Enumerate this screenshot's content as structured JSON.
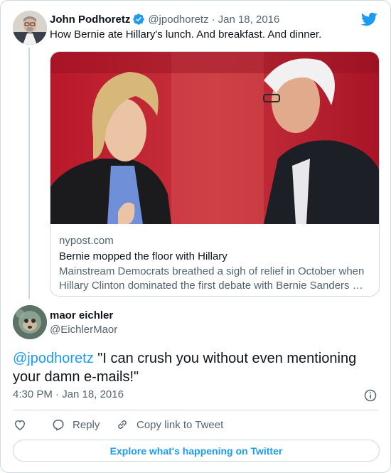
{
  "colors": {
    "accent": "#1d9bf0",
    "text": "#0f1419",
    "muted": "#536471",
    "border": "#cfd9de"
  },
  "parent_tweet": {
    "author_name": "John Podhoretz",
    "verified_icon": "verified-badge-icon",
    "handle": "@jpodhoretz",
    "separator": "·",
    "date": "Jan 18, 2016",
    "text": "How Bernie ate Hillary's lunch. And breakfast. And dinner.",
    "link_card": {
      "domain": "nypost.com",
      "title": "Bernie mopped the floor with Hillary",
      "description": "Mainstream Democrats breathed a sigh of relief in October when Hillary Clinton dominated the first debate with Bernie Sanders …"
    }
  },
  "reply_tweet": {
    "author_name": "maor eichler",
    "handle": "@EichlerMaor",
    "mention": "@jpodhoretz",
    "text": " \"I can crush you without even mentioning your damn e-mails!\"",
    "timestamp": "4:30 PM · Jan 18, 2016"
  },
  "actions": {
    "like_icon": "heart-icon",
    "reply_label": "Reply",
    "copy_label": "Copy link to Tweet"
  },
  "footer": {
    "explore_label": "Explore what's happening on Twitter"
  },
  "icons": {
    "brand": "twitter-bird-icon",
    "info": "info-icon",
    "reply": "reply-bubble-icon",
    "copy": "link-icon"
  }
}
